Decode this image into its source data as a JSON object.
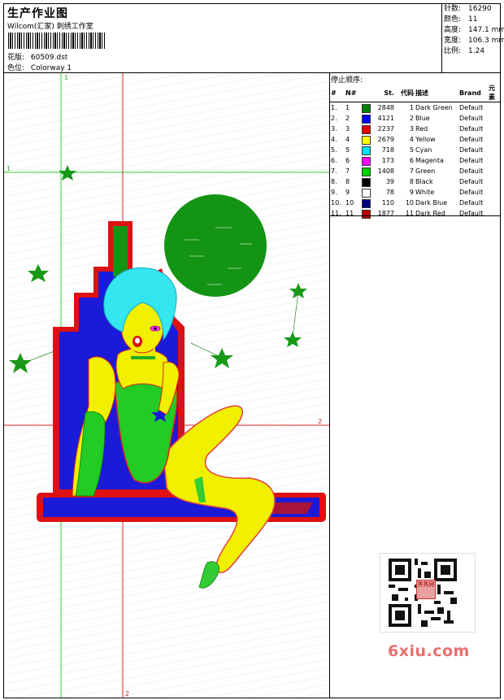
{
  "header": {
    "title": "生产作业图",
    "studio": "Wilcom(汇家) 刺绣工作室",
    "pattern_label": "花版:",
    "pattern_value": "60509.dst",
    "colorway_label": "色位:",
    "colorway_value": "Colorway 1"
  },
  "stats": [
    {
      "label": "针数:",
      "value": "16290"
    },
    {
      "label": "颜色:",
      "value": "11"
    },
    {
      "label": "高度:",
      "value": "147.1 mm"
    },
    {
      "label": "宽度:",
      "value": "106.3 mm"
    },
    {
      "label": "比例:",
      "value": "1.24"
    }
  ],
  "guides": {
    "one_top": "1",
    "one_left": "1",
    "two_right": "2",
    "two_bottom": "2"
  },
  "stop_sequence": {
    "title": "停止顺序:",
    "columns": [
      "#",
      "N#",
      "St.",
      "代码",
      "描述",
      "Brand",
      "元素"
    ],
    "rows": [
      {
        "n": "1.",
        "nn": "1",
        "st": "2848",
        "code": "1",
        "desc": "Dark Green",
        "brand": "Default",
        "color": "#008000"
      },
      {
        "n": "2.",
        "nn": "2",
        "st": "4121",
        "code": "2",
        "desc": "Blue",
        "brand": "Default",
        "color": "#0000ff"
      },
      {
        "n": "3.",
        "nn": "3",
        "st": "2237",
        "code": "3",
        "desc": "Red",
        "brand": "Default",
        "color": "#e00000"
      },
      {
        "n": "4.",
        "nn": "4",
        "st": "2679",
        "code": "4",
        "desc": "Yellow",
        "brand": "Default",
        "color": "#ffff00"
      },
      {
        "n": "5.",
        "nn": "5",
        "st": "718",
        "code": "5",
        "desc": "Cyan",
        "brand": "Default",
        "color": "#00e0ff"
      },
      {
        "n": "6.",
        "nn": "6",
        "st": "173",
        "code": "6",
        "desc": "Magenta",
        "brand": "Default",
        "color": "#ff00ff"
      },
      {
        "n": "7.",
        "nn": "7",
        "st": "1408",
        "code": "7",
        "desc": "Green",
        "brand": "Default",
        "color": "#00d000"
      },
      {
        "n": "8.",
        "nn": "8",
        "st": "39",
        "code": "8",
        "desc": "Black",
        "brand": "Default",
        "color": "#000000"
      },
      {
        "n": "9.",
        "nn": "9",
        "st": "78",
        "code": "9",
        "desc": "White",
        "brand": "Default",
        "color": "#ffffff"
      },
      {
        "n": "10.",
        "nn": "10",
        "st": "110",
        "code": "10",
        "desc": "Dark Blue",
        "brand": "Default",
        "color": "#000080"
      },
      {
        "n": "11.",
        "nn": "11",
        "st": "1877",
        "code": "11",
        "desc": "Dark Red",
        "brand": "Default",
        "color": "#c00000"
      }
    ]
  },
  "watermark": {
    "site": "6xiu.com",
    "stamp": "秀秀网"
  }
}
